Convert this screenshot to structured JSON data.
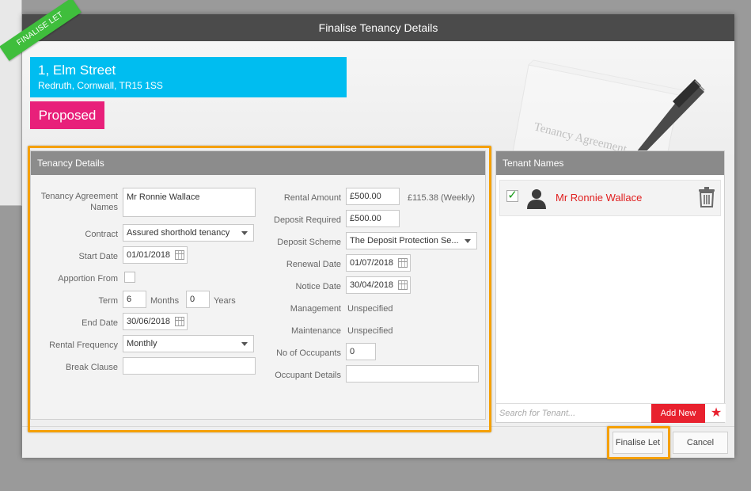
{
  "ribbon": {
    "label": "FINALISE LET",
    "color": "#3fbe3c"
  },
  "modal": {
    "title": "Finalise Tenancy Details"
  },
  "banner": {
    "art_text": "Tenancy Agreement"
  },
  "property": {
    "address_line1": "1, Elm Street",
    "address_line2": "Redruth, Cornwall, TR15 1SS",
    "status": "Proposed",
    "address_color": "#00bdf0",
    "status_color": "#e8207a"
  },
  "tenancy": {
    "title": "Tenancy Details",
    "agreement_names_label": "Tenancy Agreement Names",
    "agreement_names_value": "Mr Ronnie Wallace",
    "contract_label": "Contract",
    "contract_value": "Assured shorthold tenancy",
    "start_date_label": "Start Date",
    "start_date_value": "01/01/2018",
    "apportion_label": "Apportion From",
    "term_label": "Term",
    "term_months_value": "6",
    "term_months_label": "Months",
    "term_years_value": "0",
    "term_years_label": "Years",
    "end_date_label": "End Date",
    "end_date_value": "30/06/2018",
    "rental_frequency_label": "Rental Frequency",
    "rental_frequency_value": "Monthly",
    "break_clause_label": "Break Clause",
    "break_clause_value": "",
    "rental_amount_label": "Rental Amount",
    "rental_amount_value": "£500.00",
    "rental_weekly": "£115.38 (Weekly)",
    "deposit_required_label": "Deposit Required",
    "deposit_required_value": "£500.00",
    "deposit_scheme_label": "Deposit Scheme",
    "deposit_scheme_value": "The Deposit Protection Se...",
    "renewal_date_label": "Renewal Date",
    "renewal_date_value": "01/07/2018",
    "notice_date_label": "Notice Date",
    "notice_date_value": "30/04/2018",
    "management_label": "Management",
    "management_value": "Unspecified",
    "maintenance_label": "Maintenance",
    "maintenance_value": "Unspecified",
    "occupants_label": "No of Occupants",
    "occupants_value": "0",
    "occupant_details_label": "Occupant Details",
    "occupant_details_value": ""
  },
  "tenants": {
    "title": "Tenant Names",
    "items": [
      {
        "name": "Mr Ronnie Wallace",
        "checked": true
      }
    ],
    "search_placeholder": "Search for Tenant...",
    "add_new_label": "Add New"
  },
  "footer": {
    "finalise_label": "Finalise Let",
    "cancel_label": "Cancel"
  },
  "colors": {
    "highlight": "#f5a000",
    "header": "#4b4b4b",
    "panel_title": "#8a8a8a",
    "danger": "#e8212e"
  }
}
